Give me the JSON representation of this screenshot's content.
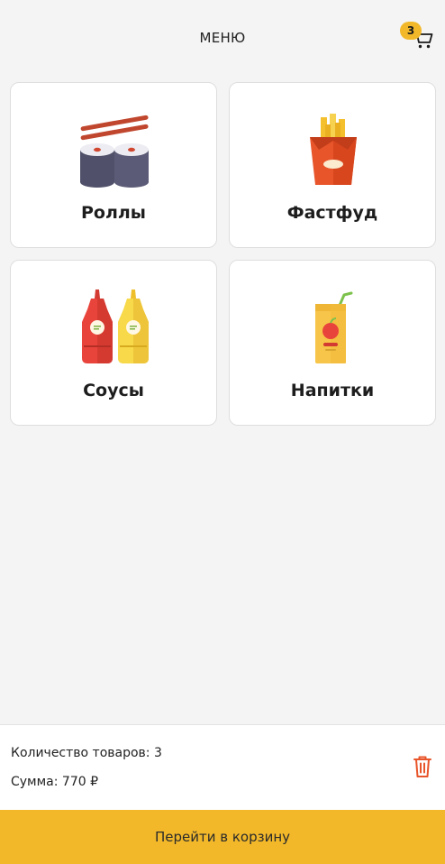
{
  "header": {
    "title": "МЕНЮ",
    "cart_icon": "cart-icon",
    "cart_count": "3"
  },
  "categories": [
    {
      "label": "Роллы",
      "icon": "sushi-rolls-icon"
    },
    {
      "label": "Фастфуд",
      "icon": "french-fries-icon"
    },
    {
      "label": "Соусы",
      "icon": "sauce-bottles-icon"
    },
    {
      "label": "Напитки",
      "icon": "juice-box-icon"
    }
  ],
  "summary": {
    "quantity_text": "Количество товаров: 3",
    "sum_text": "Сумма: 770 ₽",
    "clear_icon": "trash-icon"
  },
  "checkout": {
    "label": "Перейти в корзину"
  },
  "colors": {
    "accent": "#f2b82a",
    "danger": "#e8552a",
    "background": "#f4f4f4"
  }
}
